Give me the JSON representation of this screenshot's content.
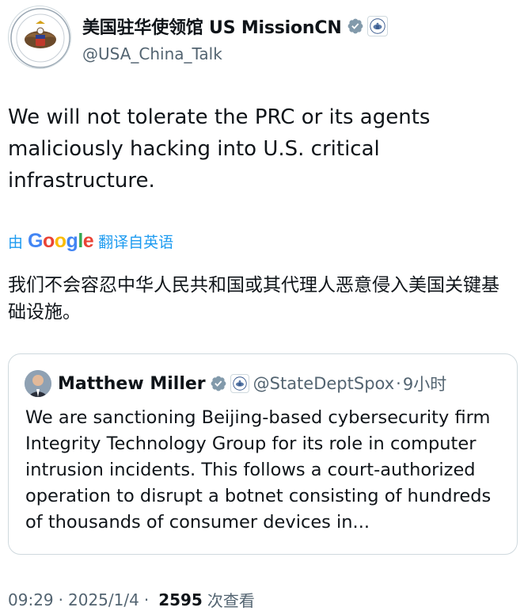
{
  "author": {
    "display_name": "美国驻华使领馆 US MissionCN",
    "handle": "@USA_China_Talk",
    "avatar_icon": "us-embassy-seal-icon",
    "verified_icon": "verified-badge-icon",
    "affiliation_icon": "us-state-department-seal-icon"
  },
  "tweet": {
    "text": "We will not tolerate the PRC or its agents maliciously hacking into U.S. critical infrastructure."
  },
  "translation": {
    "prefix": "由",
    "provider_letters": [
      "G",
      "o",
      "o",
      "g",
      "l",
      "e"
    ],
    "suffix": "翻译自英语",
    "text": "我们不会容忍中华人民共和国或其代理人恶意侵入美国关键基础设施。"
  },
  "quoted_tweet": {
    "display_name": "Matthew Miller",
    "handle": "@StateDeptSpox",
    "separator": "·",
    "time": "9小时",
    "text": "We are sanctioning Beijing-based cybersecurity firm Integrity Technology Group for its role in computer intrusion incidents. This follows a court-authorized operation to disrupt a botnet consisting of hundreds of thousands of consumer devices in..."
  },
  "meta": {
    "time": "09:29",
    "separator1": "·",
    "date": "2025/1/4",
    "separator2": "·",
    "views_count": "2595",
    "views_label": "次查看"
  },
  "colors": {
    "text_primary": "#0f1419",
    "text_secondary": "#536471",
    "link_blue": "#1d9bf0",
    "verified_gray": "#829aab",
    "border": "#cfd9de"
  }
}
